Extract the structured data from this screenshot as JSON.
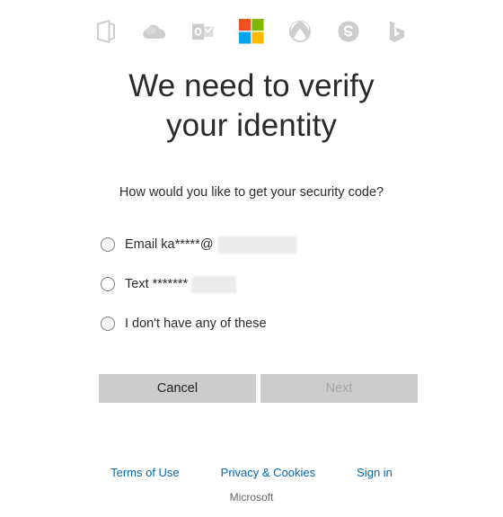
{
  "brand_icons": [
    {
      "name": "office-icon",
      "label": "Office"
    },
    {
      "name": "onedrive-icon",
      "label": "OneDrive"
    },
    {
      "name": "outlook-icon",
      "label": "Outlook"
    },
    {
      "name": "microsoft-logo-icon",
      "label": "Microsoft"
    },
    {
      "name": "xbox-icon",
      "label": "Xbox"
    },
    {
      "name": "skype-icon",
      "label": "Skype"
    },
    {
      "name": "bing-icon",
      "label": "Bing"
    }
  ],
  "heading": "We need to verify your identity",
  "sub_prompt": "How would you like to get your security code?",
  "options": [
    {
      "label": "Email ka*****@",
      "redaction": "wide",
      "selected": false
    },
    {
      "label": "Text *******",
      "redaction": "narrow",
      "selected": false
    },
    {
      "label": "I don't have any of these",
      "redaction": null,
      "selected": false
    }
  ],
  "buttons": {
    "cancel": "Cancel",
    "next": "Next",
    "next_disabled": true
  },
  "footer": {
    "links": [
      "Terms of Use",
      "Privacy & Cookies",
      "Sign in"
    ],
    "brand": "Microsoft"
  },
  "colors": {
    "link": "#0067b8",
    "button_bg": "#cccccc",
    "button_text": "#1f1f1f",
    "button_text_disabled": "#a6a6a6",
    "icon_gray": "#cdcdcd",
    "redaction": "#ebebeb",
    "ms_red": "#f25022",
    "ms_green": "#7fba00",
    "ms_blue": "#00a4ef",
    "ms_yellow": "#ffb900"
  }
}
